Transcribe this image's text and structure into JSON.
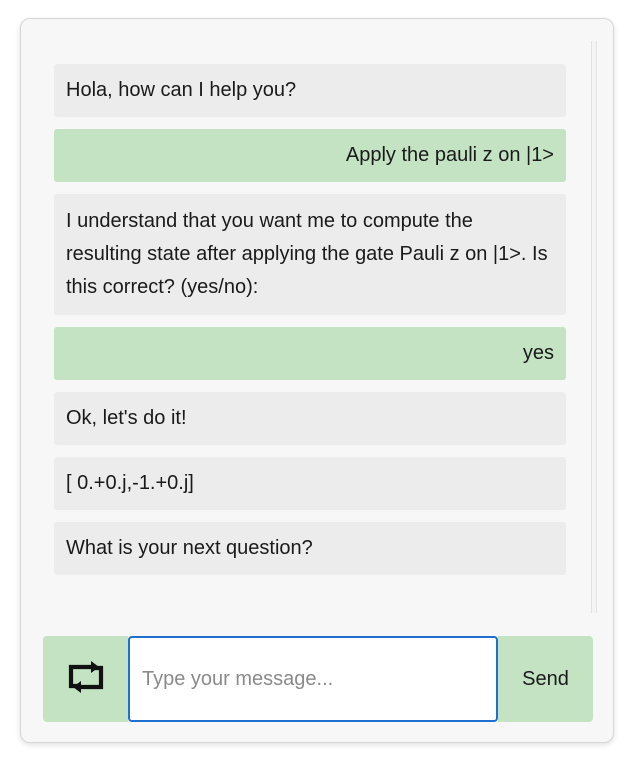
{
  "messages": [
    {
      "role": "bot",
      "text": "Hola, how can I help you?"
    },
    {
      "role": "user",
      "text": "Apply the pauli z on |1>"
    },
    {
      "role": "bot",
      "text": "I understand that you want me to compute the resulting state after applying the gate Pauli z on |1>. Is this correct? (yes/no):"
    },
    {
      "role": "user",
      "text": "yes"
    },
    {
      "role": "bot",
      "text": "Ok, let's do it!"
    },
    {
      "role": "bot",
      "text": "[ 0.+0.j,-1.+0.j]"
    },
    {
      "role": "bot",
      "text": "What is your next question?"
    }
  ],
  "input": {
    "placeholder": "Type your message...",
    "value": ""
  },
  "send_label": "Send",
  "icons": {
    "reset": "repeat-icon"
  },
  "colors": {
    "user_bubble": "#c3e3c3",
    "bot_bubble": "#ececec",
    "input_border": "#1f6fd1"
  }
}
